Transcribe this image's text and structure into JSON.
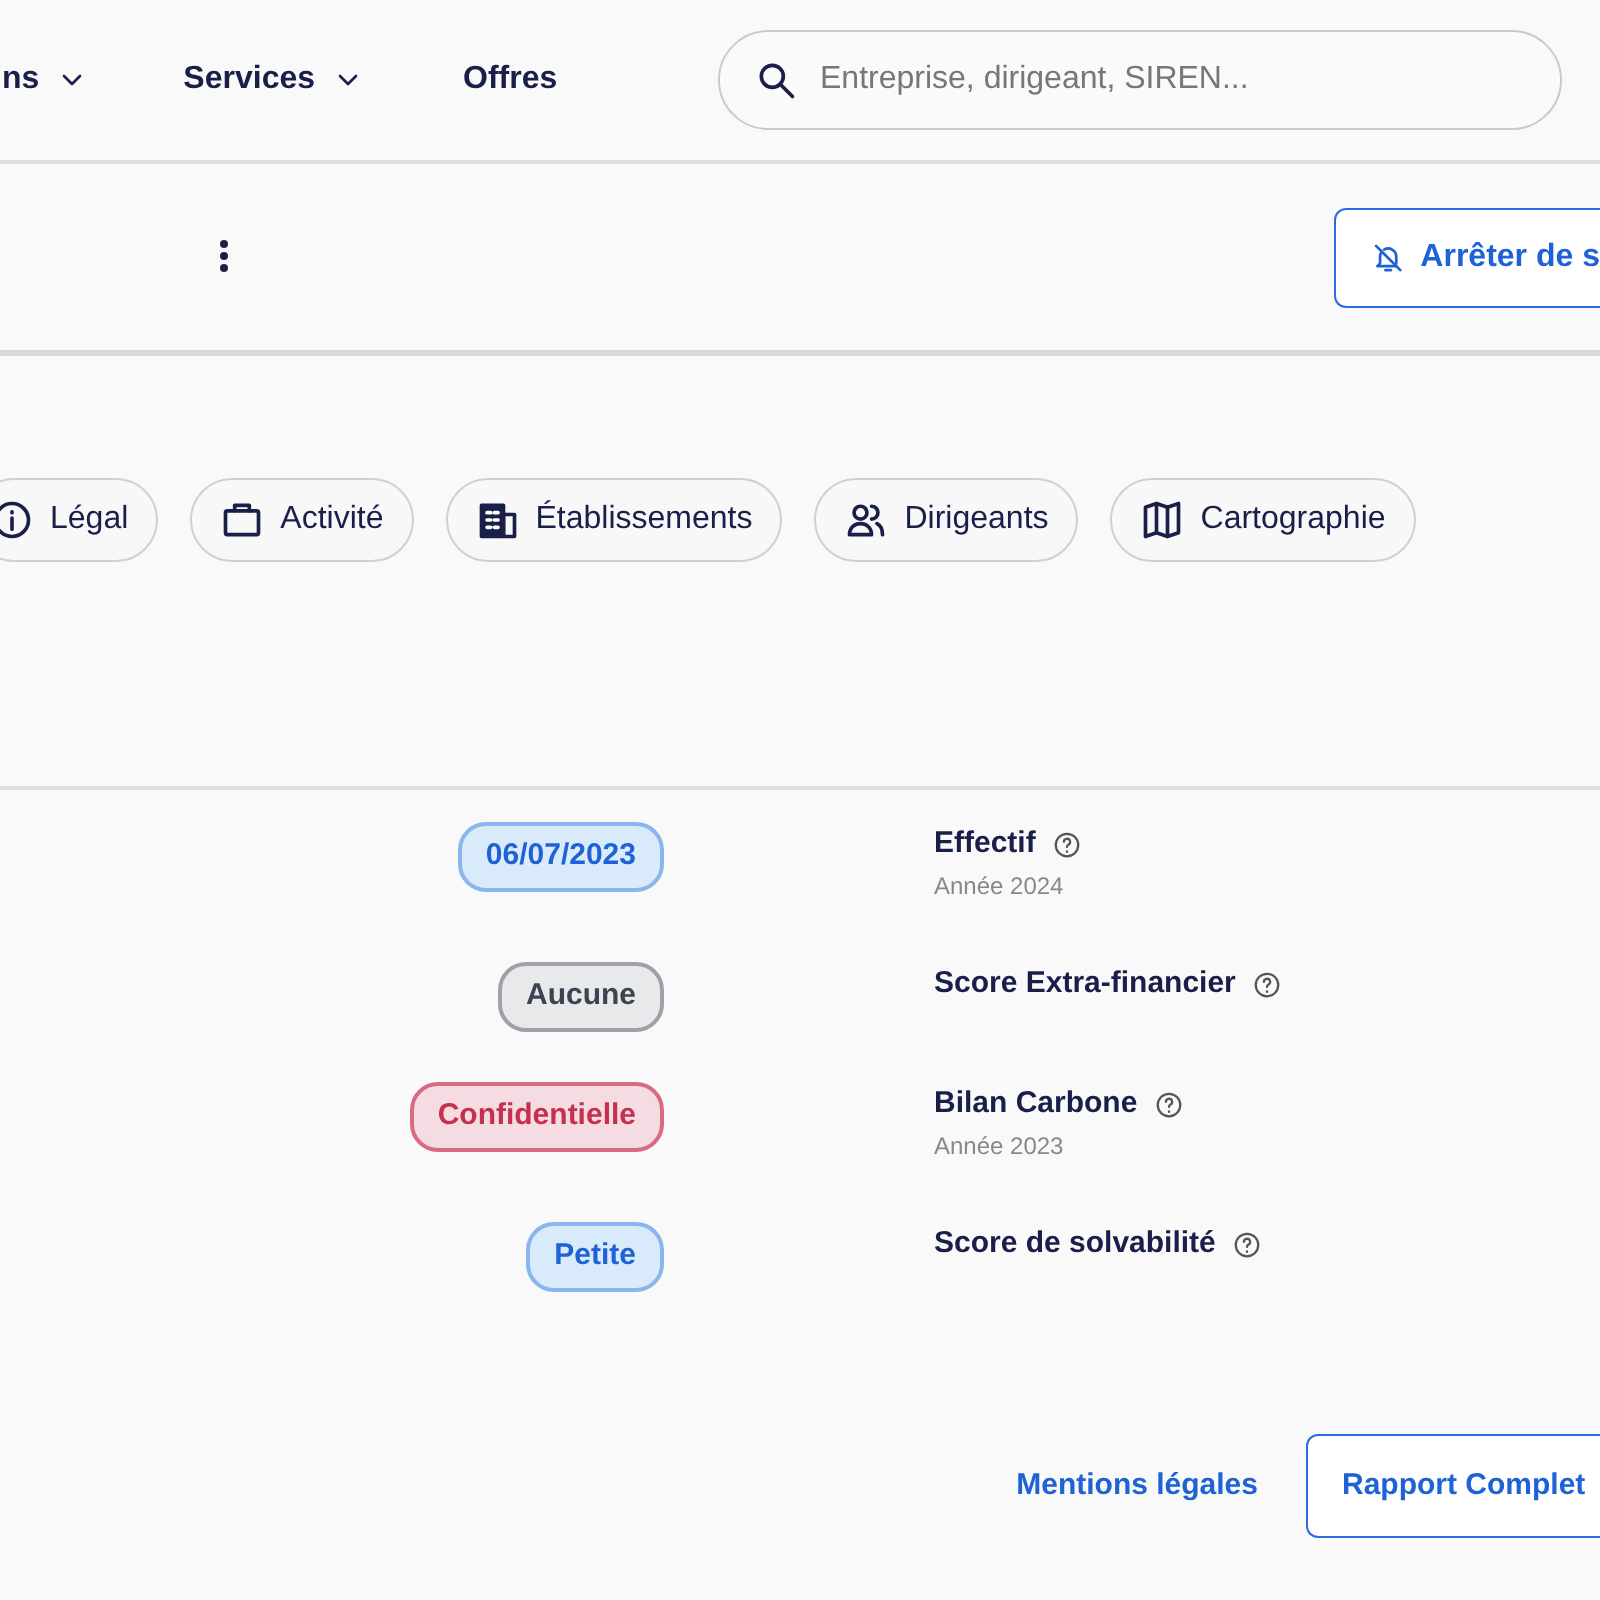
{
  "nav": {
    "items": [
      {
        "label": "ns",
        "dropdown": true
      },
      {
        "label": "Services",
        "dropdown": true
      },
      {
        "label": "Offres",
        "dropdown": false
      }
    ],
    "search": {
      "placeholder": "Entreprise, dirigeant, SIREN..."
    }
  },
  "toolbar": {
    "unfollow_button": "Arrêter de s"
  },
  "tabs": [
    {
      "label": "Légal",
      "kind": "info"
    },
    {
      "label": "Activité",
      "kind": "briefcase"
    },
    {
      "label": "Établissements",
      "kind": "building"
    },
    {
      "label": "Dirigeants",
      "kind": "people"
    },
    {
      "label": "Cartographie",
      "kind": "map"
    }
  ],
  "rows": [
    {
      "value": "06/07/2023",
      "kind": "info",
      "label": "Effectif",
      "sub": "Année 2024"
    },
    {
      "value": "Aucune",
      "kind": "neutral",
      "label": "Score Extra-financier"
    },
    {
      "value": "Confidentielle",
      "kind": "danger",
      "label": "Bilan Carbone",
      "sub": "Année 2023"
    },
    {
      "value": "Petite",
      "kind": "info",
      "label": "Score de solvabilité"
    }
  ],
  "footer": {
    "link": "Mentions légales",
    "button": "Rapport Complet"
  }
}
